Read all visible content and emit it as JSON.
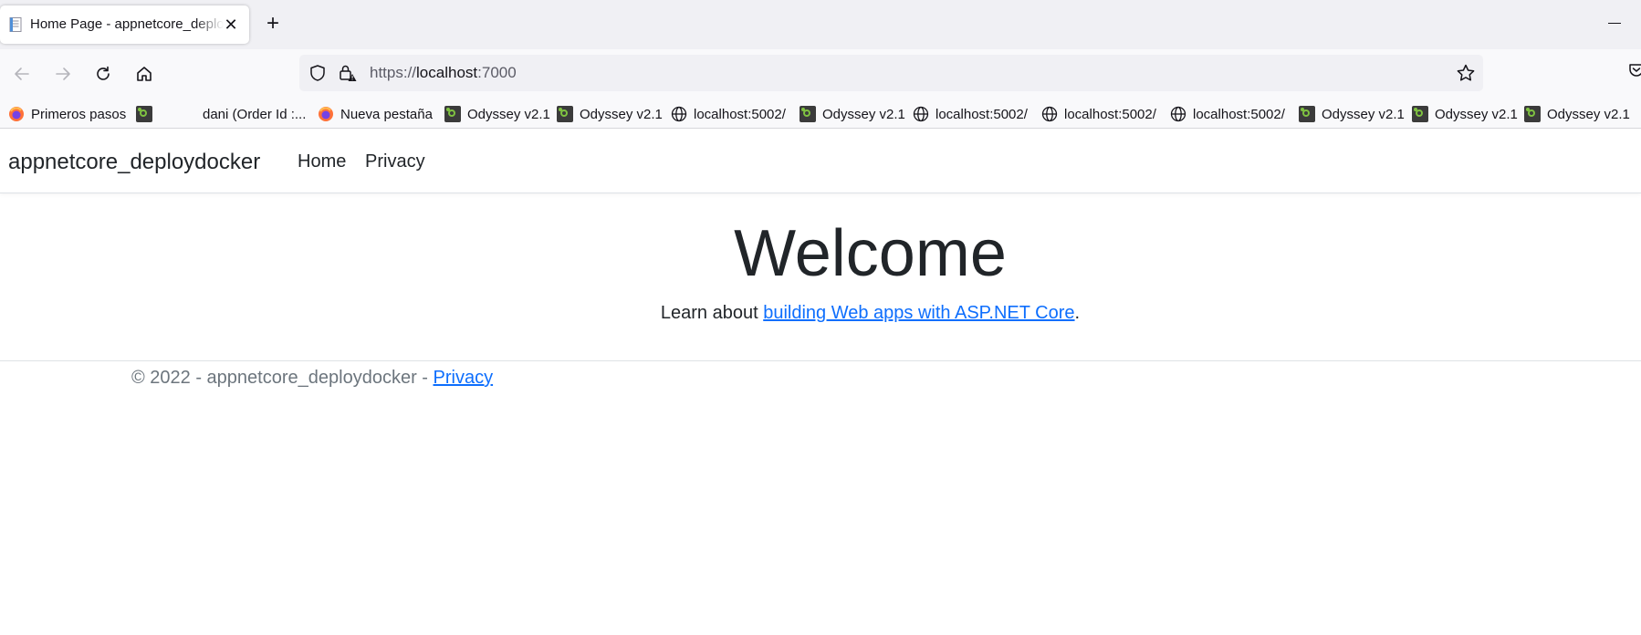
{
  "browser": {
    "tab": {
      "title": "Home Page - appnetcore_deploydocker",
      "close": "✕"
    },
    "new_tab": "+",
    "url": {
      "scheme": "https://",
      "host": "localhost",
      "port": ":7000"
    },
    "bookmarks": [
      {
        "label": "Primeros pasos",
        "icon": "firefox-icon"
      },
      {
        "label": "",
        "icon": "odyssey-icon"
      },
      {
        "label": "dani (Order Id :...",
        "icon": "none"
      },
      {
        "label": "Nueva pestaña",
        "icon": "firefox-icon"
      },
      {
        "label": "Odyssey v2.1",
        "icon": "odyssey-icon"
      },
      {
        "label": "Odyssey v2.1",
        "icon": "odyssey-icon"
      },
      {
        "label": "localhost:5002/",
        "icon": "globe-icon"
      },
      {
        "label": "Odyssey v2.1",
        "icon": "odyssey-icon"
      },
      {
        "label": "localhost:5002/",
        "icon": "globe-icon"
      },
      {
        "label": "localhost:5002/",
        "icon": "globe-icon"
      },
      {
        "label": "localhost:5002/",
        "icon": "globe-icon"
      },
      {
        "label": "Odyssey v2.1",
        "icon": "odyssey-icon"
      },
      {
        "label": "Odyssey v2.1",
        "icon": "odyssey-icon"
      },
      {
        "label": "Odyssey v2.1",
        "icon": "odyssey-icon"
      }
    ]
  },
  "site": {
    "brand": "appnetcore_deploydocker",
    "nav": {
      "home": "Home",
      "privacy": "Privacy"
    },
    "heading": "Welcome",
    "lead": {
      "prefix": "Learn about ",
      "link": "building Web apps with ASP.NET Core",
      "suffix": "."
    },
    "footer": {
      "text": "© 2022 - appnetcore_deploydocker - ",
      "link": "Privacy"
    }
  },
  "colors": {
    "link": "#0d6efd",
    "text": "#212529",
    "muted": "#6c757d",
    "chrome": "#f0f0f4"
  }
}
